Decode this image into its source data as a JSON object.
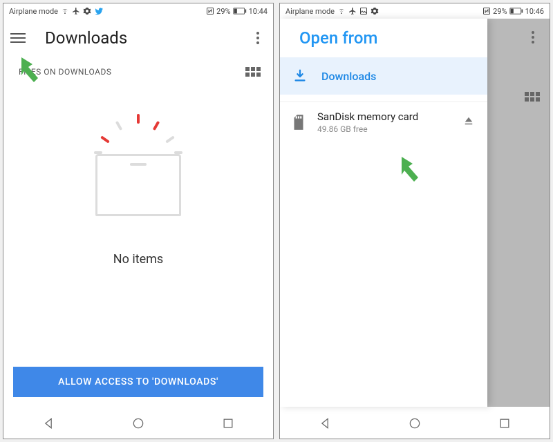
{
  "left": {
    "status": {
      "mode": "Airplane mode",
      "battery_pct": "29%",
      "time": "10:44"
    },
    "toolbar": {
      "title": "Downloads"
    },
    "subhead": {
      "label": "FILES ON DOWNLOADS"
    },
    "empty": {
      "message": "No items"
    },
    "buttons": {
      "permission": "ALLOW ACCESS TO 'DOWNLOADS'"
    }
  },
  "right": {
    "status": {
      "mode": "Airplane mode",
      "battery_pct": "29%",
      "time": "10:46"
    },
    "drawer": {
      "title": "Open from",
      "items": {
        "downloads": "Downloads"
      },
      "storage": {
        "name": "SanDisk memory card",
        "free": "49.86 GB free"
      }
    }
  }
}
